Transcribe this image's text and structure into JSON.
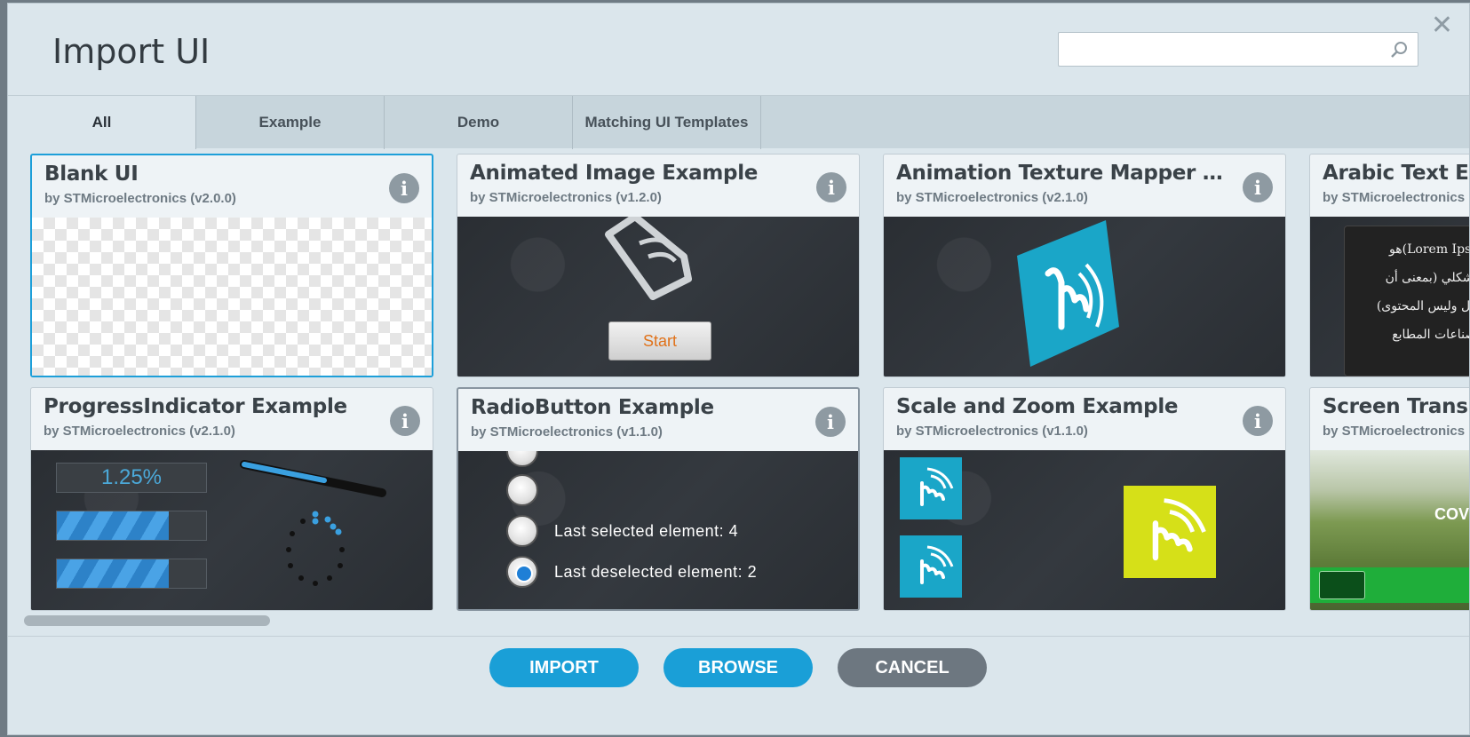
{
  "dialog": {
    "title": "Import UI",
    "close_icon": "close-icon",
    "search": {
      "placeholder": "",
      "value": "",
      "icon": "search-icon"
    }
  },
  "tabs": [
    {
      "label": "All",
      "active": true
    },
    {
      "label": "Example",
      "active": false
    },
    {
      "label": "Demo",
      "active": false
    },
    {
      "label": "Matching UI Templates",
      "active": false
    }
  ],
  "cards": [
    {
      "title": "Blank UI",
      "subtitle": "by STMicroelectronics (v2.0.0)",
      "selected": true
    },
    {
      "title": "Animated Image Example",
      "subtitle": "by STMicroelectronics (v1.2.0)",
      "button_label": "Start"
    },
    {
      "title": "Animation Texture Mapper Exa...",
      "subtitle": "by STMicroelectronics (v2.1.0)"
    },
    {
      "title": "Arabic Text Exa",
      "subtitle": "by STMicroelectronics (",
      "preview_lines": [
        "(Lorem Ipsum)هو",
        "نص شكلي (بمعنى أن",
        "الشكل وليس المحتوى)",
        "في صناعات المطابع"
      ]
    },
    {
      "title": "ProgressIndicator Example",
      "subtitle": "by STMicroelectronics (v2.1.0)",
      "percent": "1.25%",
      "bar_fill": 0.75
    },
    {
      "title": "RadioButton Example",
      "subtitle": "by STMicroelectronics (v1.1.0)",
      "label_selected": "Last selected element: 4",
      "label_deselected": "Last deselected element: 2"
    },
    {
      "title": "Scale and Zoom Example",
      "subtitle": "by STMicroelectronics (v1.1.0)"
    },
    {
      "title": "Screen Transiti",
      "subtitle": "by STMicroelectronics",
      "preview_text": "COV"
    }
  ],
  "footer": {
    "import_label": "IMPORT",
    "browse_label": "BROWSE",
    "cancel_label": "CANCEL"
  },
  "colors": {
    "accent": "#1a9fd7",
    "cancel": "#6d7780",
    "dialog_bg": "#dbe6ec"
  }
}
